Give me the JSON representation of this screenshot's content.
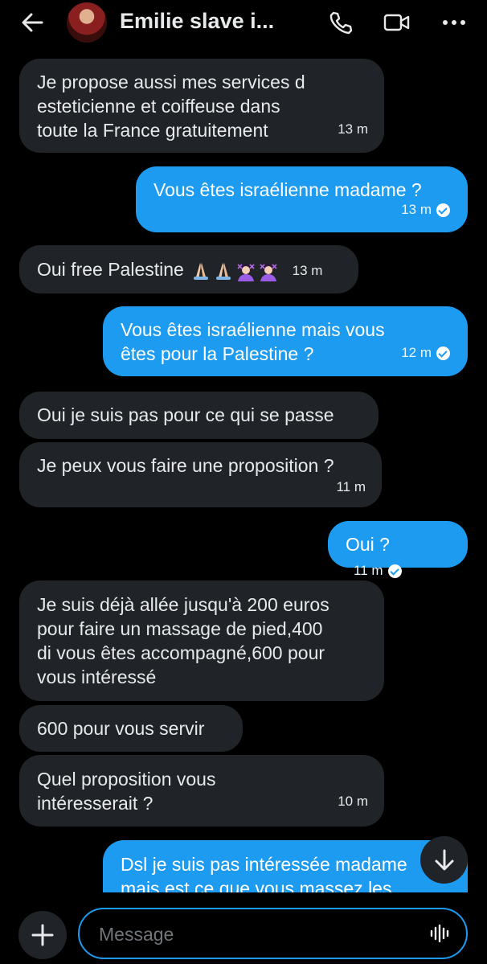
{
  "header": {
    "title": "Emilie slave i...",
    "icons": [
      "back-arrow-icon",
      "avatar",
      "phone-icon",
      "video-icon",
      "more-icon"
    ]
  },
  "messages": [
    {
      "dir": "in",
      "text": "Je propose aussi mes services d\nesteticienne et coiffeuse dans\ntoute la France gratuitement",
      "time": "13 m"
    },
    {
      "dir": "out",
      "text": "Vous êtes israélienne madame ?",
      "time": "13 m",
      "status": "seen"
    },
    {
      "dir": "in",
      "text": "Oui free Palestine",
      "emojis": [
        "folded-hands",
        "folded-hands",
        "person-gesturing-no",
        "person-gesturing-no"
      ],
      "time": "13 m"
    },
    {
      "dir": "out",
      "text": "Vous êtes israélienne mais vous\nêtes pour la Palestine ?",
      "time": "12 m",
      "status": "seen"
    },
    {
      "dir": "in",
      "text": "Oui je suis pas pour ce qui se passe"
    },
    {
      "dir": "in",
      "text": "Je peux vous faire une proposition ?",
      "time": "11 m"
    },
    {
      "dir": "out",
      "text": "Oui ?",
      "time": "11 m",
      "status": "seen"
    },
    {
      "dir": "in",
      "text": "Je suis déjà allée jusqu'à 200 euros\npour faire un massage de pied,400\ndi vous êtes accompagné,600 pour\nvous intéressé"
    },
    {
      "dir": "in",
      "text": "600 pour vous servir"
    },
    {
      "dir": "in",
      "text": "Quel proposition vous\nintéresserait ?",
      "time": "10 m"
    },
    {
      "dir": "out",
      "text": "Dsl je suis pas intéressée madame\nmais est ce que vous massez les",
      "partial": true
    }
  ],
  "composer": {
    "placeholder": "Message",
    "icons": [
      "plus-icon",
      "voice-wave-icon",
      "scroll-down-arrow-icon"
    ]
  },
  "colors": {
    "background": "#000000",
    "incoming_bubble": "#202327",
    "outgoing_bubble": "#1d9bf0",
    "text": "#e7e9ea",
    "placeholder": "#71767b"
  }
}
